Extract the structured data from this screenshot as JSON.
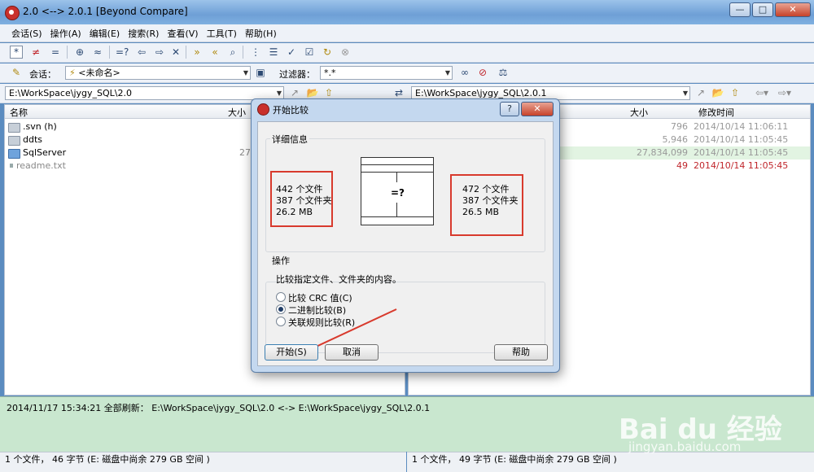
{
  "window": {
    "title": "2.0 <--> 2.0.1  [Beyond Compare]",
    "min_label": "—",
    "max_label": "□",
    "close_label": "✕"
  },
  "menu": [
    "会话(S)",
    "操作(A)",
    "编辑(E)",
    "搜索(R)",
    "查看(V)",
    "工具(T)",
    "帮助(H)"
  ],
  "toolbar2": {
    "session_label": "会话：",
    "session_value": "<未命名>",
    "filter_label": "过滤器：",
    "filter_value": "*.*"
  },
  "left_pane": {
    "path": "E:\\WorkSpace\\jygy_SQL\\2.0",
    "col_name": "名称",
    "col_size": "大小",
    "rows": [
      {
        "name": ".svn  (h)",
        "size": ""
      },
      {
        "name": "ddts",
        "size": ""
      },
      {
        "name": "SqlServer",
        "size": "27"
      },
      {
        "name": "readme.txt",
        "size": ""
      }
    ]
  },
  "right_pane": {
    "path": "E:\\WorkSpace\\jygy_SQL\\2.0.1",
    "col_size": "大小",
    "col_modified": "修改时间",
    "rows": [
      {
        "size": "796",
        "modified": "2014/10/14 11:06:11"
      },
      {
        "size": "5,946",
        "modified": "2014/10/14 11:05:45"
      },
      {
        "size": "27,834,099",
        "modified": "2014/10/14 11:05:45"
      },
      {
        "size": "49",
        "modified": "2014/10/14 11:05:45"
      }
    ]
  },
  "log": {
    "text": "2014/11/17 15:34:21  全部刷新：  E:\\WorkSpace\\jygy_SQL\\2.0 <-> E:\\WorkSpace\\jygy_SQL\\2.0.1"
  },
  "status": {
    "left": "1 个文件， 46 字节  (E: 磁盘中尚余 279 GB 空间 )",
    "right": "1 个文件， 49 字节  (E: 磁盘中尚余 279 GB 空间 )"
  },
  "dialog": {
    "title": "开始比较",
    "help_label": "?",
    "close_label": "✕",
    "details_title": "详细信息",
    "left_stats": [
      "442 个文件",
      "387 个文件夹",
      "26.2 MB"
    ],
    "right_stats": [
      "472 个文件",
      "387 个文件夹",
      "26.5 MB"
    ],
    "compare_symbol": "=?",
    "ops_title": "操作",
    "ops_desc": "比较指定文件、文件夹的内容。",
    "options": [
      "比较 CRC 值(C)",
      "二进制比较(B)",
      "关联规则比较(R)"
    ],
    "selected_option": 1,
    "start_label": "开始(S)",
    "cancel_label": "取消",
    "help_button_label": "帮助"
  },
  "watermark": {
    "brand": "Bai  du 经验",
    "url": "jingyan.baidu.com"
  },
  "colors": {
    "accent_red": "#d83a2d",
    "log_bg": "#c9e7cf",
    "newer_text": "#c0262c"
  }
}
